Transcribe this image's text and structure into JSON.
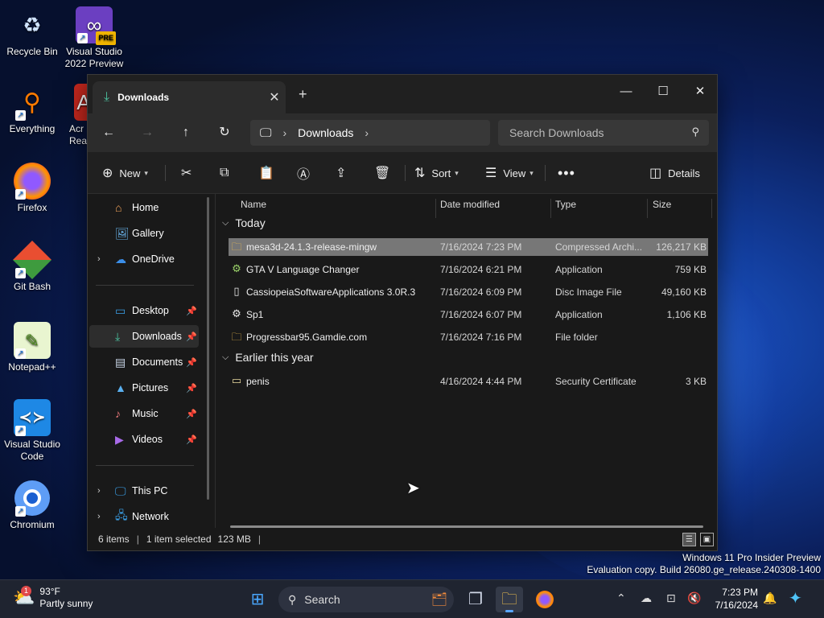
{
  "desktop": {
    "icons": [
      {
        "label": "Recycle Bin",
        "glyph": "♻",
        "icon": "recycle-bin-icon"
      },
      {
        "label": "Visual Studio 2022 Preview",
        "glyph": "∞",
        "badge": "PRE",
        "icon": "visual-studio-icon"
      },
      {
        "label": "Everything",
        "glyph": "🔍",
        "icon": "everything-search-icon"
      },
      {
        "label": "Acr Rea",
        "glyph": "A",
        "icon": "acrobat-reader-icon"
      },
      {
        "label": "Firefox",
        "glyph": "🦊",
        "icon": "firefox-icon"
      },
      {
        "label": "Git Bash",
        "glyph": "◆",
        "icon": "git-bash-icon"
      },
      {
        "label": "Notepad++",
        "glyph": "📝",
        "icon": "notepad-plus-plus-icon"
      },
      {
        "label": "Visual Studio Code",
        "glyph": "❮❯",
        "icon": "vscode-icon"
      },
      {
        "label": "Chromium",
        "glyph": "◎",
        "icon": "chromium-icon"
      }
    ],
    "watermark_line1": "Windows 11 Pro Insider Preview",
    "watermark_line2": "Evaluation copy. Build 26080.ge_release.240308-1400"
  },
  "explorer": {
    "tab_title": "Downloads",
    "breadcrumb_location": "Downloads",
    "search_placeholder": "Search Downloads",
    "toolbar": {
      "new_label": "New",
      "sort_label": "Sort",
      "view_label": "View",
      "details_label": "Details"
    },
    "nav": {
      "home": "Home",
      "gallery": "Gallery",
      "onedrive": "OneDrive",
      "desktop": "Desktop",
      "downloads": "Downloads",
      "documents": "Documents",
      "pictures": "Pictures",
      "music": "Music",
      "videos": "Videos",
      "this_pc": "This PC",
      "network": "Network"
    },
    "columns": {
      "name": "Name",
      "date": "Date modified",
      "type": "Type",
      "size": "Size"
    },
    "groups": {
      "today": "Today",
      "earlier": "Earlier this year"
    },
    "files_today": [
      {
        "name": "mesa3d-24.1.3-release-mingw",
        "date": "7/16/2024 7:23 PM",
        "type": "Compressed Archi...",
        "size": "126,217 KB",
        "icon": "zip-folder-icon",
        "glyph": "🗜",
        "selected": true
      },
      {
        "name": "GTA V Language Changer",
        "date": "7/16/2024 6:21 PM",
        "type": "Application",
        "size": "759 KB",
        "icon": "application-icon",
        "glyph": "⚙"
      },
      {
        "name": "CassiopeiaSoftwareApplications 3.0R.3",
        "date": "7/16/2024 6:09 PM",
        "type": "Disc Image File",
        "size": "49,160 KB",
        "icon": "disc-image-icon",
        "glyph": "📄"
      },
      {
        "name": "Sp1",
        "date": "7/16/2024 6:07 PM",
        "type": "Application",
        "size": "1,106 KB",
        "icon": "application-icon",
        "glyph": "⚙"
      },
      {
        "name": "Progressbar95.Gamdie.com",
        "date": "7/16/2024 7:16 PM",
        "type": "File folder",
        "size": "",
        "icon": "folder-icon",
        "glyph": "📁"
      }
    ],
    "files_earlier": [
      {
        "name": "penis",
        "date": "4/16/2024 4:44 PM",
        "type": "Security Certificate",
        "size": "3 KB",
        "icon": "certificate-icon",
        "glyph": "🪪"
      }
    ],
    "status": {
      "count": "6 items",
      "selected": "1 item selected",
      "size": "123 MB"
    }
  },
  "taskbar": {
    "temperature": "93°F",
    "weather_desc": "Partly sunny",
    "weather_badge": "1",
    "search_label": "Search",
    "time": "7:23 PM",
    "date": "7/16/2024"
  }
}
